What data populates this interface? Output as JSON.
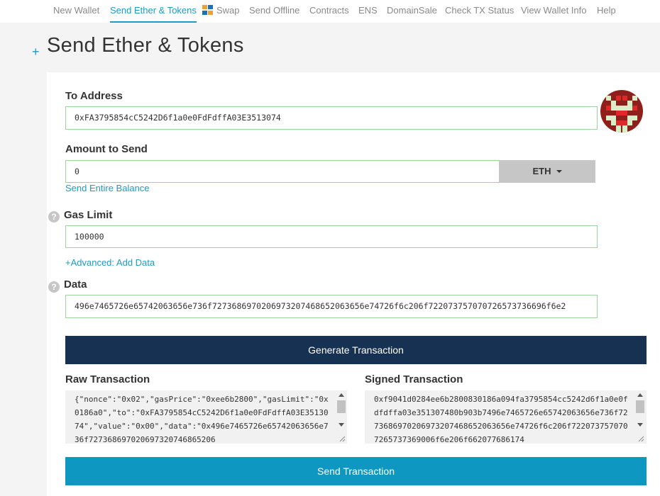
{
  "nav": {
    "items": [
      {
        "label": "New Wallet"
      },
      {
        "label": "Send Ether & Tokens"
      },
      {
        "label": "Swap"
      },
      {
        "label": "Send Offline"
      },
      {
        "label": "Contracts"
      },
      {
        "label": "ENS"
      },
      {
        "label": "DomainSale"
      },
      {
        "label": "Check TX Status"
      },
      {
        "label": "View Wallet Info"
      },
      {
        "label": "Help"
      }
    ],
    "active_index": 1
  },
  "page": {
    "title": "Send Ether & Tokens",
    "expand_glyph": "+"
  },
  "form": {
    "to_address": {
      "label": "To Address",
      "value": "0xFA3795854cC5242D6f1a0e0FdFdffA03E3513074"
    },
    "amount": {
      "label": "Amount to Send",
      "value": "0",
      "unit": "ETH",
      "send_entire_balance": "Send Entire Balance"
    },
    "gas_limit": {
      "label": "Gas Limit",
      "value": "100000"
    },
    "advanced_link": "+Advanced: Add Data",
    "data": {
      "label": "Data",
      "value": "496e7465726e65742063656e736f7273686970206973207468652063656e74726f6c206f722073757070726573736696f6e2"
    },
    "help_glyph": "?"
  },
  "buttons": {
    "generate": "Generate Transaction",
    "send": "Send Transaction"
  },
  "raw_tx": {
    "label": "Raw Transaction",
    "value": "{\"nonce\":\"0x02\",\"gasPrice\":\"0xee6b2800\",\"gasLimit\":\"0x0186a0\",\"to\":\"0xFA3795854cC5242D6f1a0e0FdFdffA03E3513074\",\"value\":\"0x00\",\"data\":\"0x496e7465726e65742063656e736f727368697020697320746865206"
  },
  "signed_tx": {
    "label": "Signed Transaction",
    "value": "0xf9041d0284ee6b2800830186a094fa3795854cc5242d6f1a0e0fdfdffa03e351307480b903b7496e7465726e65742063656e736f7273686970206973207468652063656e74726f6c206f7220737570707265737369006f6e206f662077686174"
  },
  "colors": {
    "accent": "#1c9cc4",
    "navy_button": "#163151",
    "send_button": "#0e97c0",
    "valid_border": "#9ed39c"
  }
}
